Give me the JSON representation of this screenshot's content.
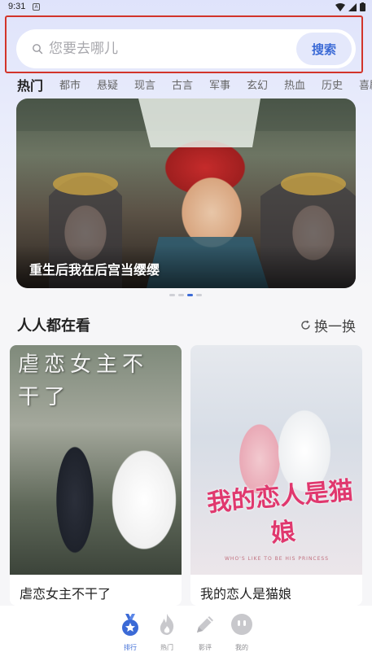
{
  "status_bar": {
    "time": "9:31",
    "notification_glyph": "A"
  },
  "search": {
    "placeholder": "您要去哪儿",
    "button_label": "搜索"
  },
  "tabs": [
    {
      "label": "热门",
      "active": true
    },
    {
      "label": "都市"
    },
    {
      "label": "悬疑"
    },
    {
      "label": "现言"
    },
    {
      "label": "古言"
    },
    {
      "label": "军事"
    },
    {
      "label": "玄幻"
    },
    {
      "label": "热血"
    },
    {
      "label": "历史"
    },
    {
      "label": "喜剧"
    }
  ],
  "banner": {
    "title": "重生后我在后宫当缨缨",
    "page_count": 4,
    "active_page": 3
  },
  "section": {
    "title": "人人都在看",
    "refresh_label": "换一换"
  },
  "cards": [
    {
      "title": "虐恋女主不干了",
      "cover_text": "虐恋女主不干了"
    },
    {
      "title": "我的恋人是猫娘",
      "cover_text": "我的恋人是猫娘",
      "cover_subtext": "WHO'S LIKE TO BE HIS PRINCESS"
    }
  ],
  "bottom_nav": [
    {
      "label": "排行",
      "icon": "ranking-medal-icon",
      "active": true
    },
    {
      "label": "热门",
      "icon": "flame-icon"
    },
    {
      "label": "影评",
      "icon": "pencil-icon"
    },
    {
      "label": "我的",
      "icon": "profile-face-icon"
    }
  ],
  "colors": {
    "accent": "#3b6ad6",
    "highlight_outline": "#d2342a",
    "nav_inactive": "#c8c8cc"
  }
}
